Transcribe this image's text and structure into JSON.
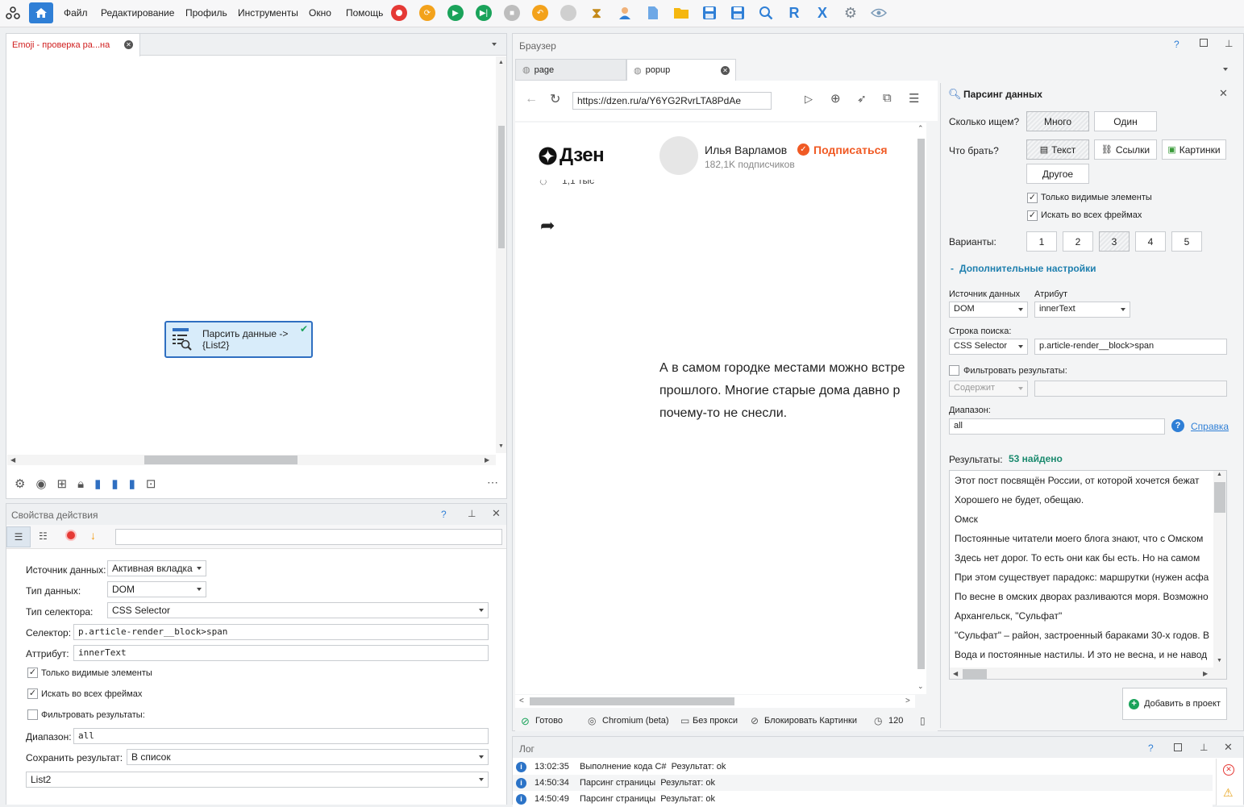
{
  "menu": {
    "items": [
      "Файл",
      "Редактирование",
      "Профиль",
      "Инструменты",
      "Окно",
      "Помощь"
    ]
  },
  "project_tab": {
    "title": "Emoji - проверка ра...на"
  },
  "node": {
    "line1": "Парсить данные ->",
    "line2": "{List2}"
  },
  "props": {
    "title": "Свойства действия",
    "help": "?",
    "source_label": "Источник данных:",
    "source_value": "Активная вкладка",
    "type_label": "Тип данных:",
    "type_value": "DOM",
    "selector_type_label": "Тип селектора:",
    "selector_type_value": "CSS Selector",
    "selector_label": "Селектор:",
    "selector_value": "p.article-render__block>span",
    "attr_label": "Аттрибут:",
    "attr_value": "innerText",
    "visible_only": "Только видимые элементы",
    "all_frames": "Искать во всех фреймах",
    "filter": "Фильтровать результаты:",
    "range_label": "Диапазон:",
    "range_value": "all",
    "save_label": "Сохранить результат:",
    "save_value": "В список",
    "list_value": "List2"
  },
  "browser": {
    "title": "Браузер",
    "help": "?",
    "tabs": [
      "page",
      "popup"
    ],
    "url": "https://dzen.ru/a/Y6YG2RvrLTA8PdAe",
    "site_logo": "Дзен",
    "author": "Илья Варламов",
    "subscribe": "Подписаться",
    "subscribers": "182,1K подписчиков",
    "partial_text": "1,1 тыс",
    "article_lines": [
      "А в самом городке местами можно встре",
      "прошлого. Многие старые дома давно р",
      "почему-то не снесли."
    ],
    "status": {
      "ready": "Готово",
      "engine": "Chromium (beta)",
      "proxy": "Без прокси",
      "images": "Блокировать Картинки",
      "timeout": "120"
    }
  },
  "parser": {
    "title": "Парсинг данных",
    "how_many_label": "Сколько ищем?",
    "how_many_opts": [
      "Много",
      "Один"
    ],
    "what_label": "Что брать?",
    "what_opts": [
      "Текст",
      "Ссылки",
      "Картинки",
      "Другое"
    ],
    "visible_only": "Только видимые элементы",
    "all_frames": "Искать во всех фреймах",
    "variants_label": "Варианты:",
    "variants": [
      "1",
      "2",
      "3",
      "4",
      "5"
    ],
    "advanced": "Дополнительные настройки",
    "source_label": "Источник данных",
    "source_value": "DOM",
    "attr_label": "Атрибут",
    "attr_value": "innerText",
    "search_label": "Строка поиска:",
    "search_type": "CSS Selector",
    "search_value": "p.article-render__block>span",
    "filter_label": "Фильтровать результаты:",
    "filter_mode": "Содержит",
    "range_label": "Диапазон:",
    "range_value": "all",
    "help_link": "Справка",
    "results_label": "Результаты:",
    "results_count": "53 найдено",
    "results": [
      "Этот пост посвящён России, от которой хочется бежат",
      "Хорошего не будет, обещаю.",
      "Омск",
      "Постоянные читатели моего блога знают, что с Омском",
      "Здесь нет дорог. То есть они как бы есть. Но на самом",
      "При этом существует парадокс: маршрутки (нужен асфа",
      "По весне в омских дворах разливаются моря. Возможно",
      "Архангельск, \"Сульфат\"",
      "\"Сульфат\" – район, застроенный бараками 30-х годов. В",
      "Вода и постоянные настилы. И это не весна, и не навод"
    ],
    "add_button": "Добавить в проект"
  },
  "log": {
    "title": "Лог",
    "help": "?",
    "rows": [
      {
        "time": "13:02:35",
        "text": "Выполнение кода C#  Результат: ok"
      },
      {
        "time": "14:50:34",
        "text": "Парсинг страницы  Результат: ok"
      },
      {
        "time": "14:50:49",
        "text": "Парсинг страницы  Результат: ok"
      }
    ]
  },
  "colors": {
    "accent": "#2f7fd6",
    "subscribe": "#f05a24",
    "found": "#1a8a6e",
    "advanced": "#1e7fae",
    "node_border": "#2f6fc1",
    "node_bg": "#d8ecfa"
  }
}
